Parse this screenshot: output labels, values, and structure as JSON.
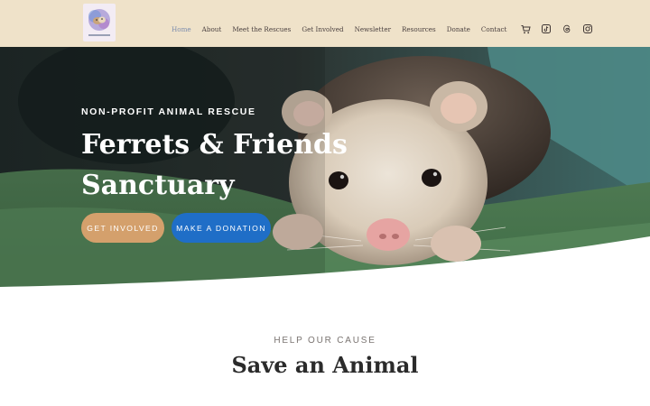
{
  "header": {
    "logo_icon": "ferret-sanctuary-logo",
    "nav": [
      {
        "label": "Home",
        "active": true
      },
      {
        "label": "About"
      },
      {
        "label": "Meet the Rescues"
      },
      {
        "label": "Get Involved"
      },
      {
        "label": "Newsletter"
      },
      {
        "label": "Resources"
      },
      {
        "label": "Donate"
      },
      {
        "label": "Contact"
      }
    ],
    "icons": [
      "cart-icon",
      "tiktok-icon",
      "threads-icon",
      "instagram-icon"
    ]
  },
  "hero": {
    "eyebrow": "NON-PROFIT ANIMAL RESCUE",
    "title_line1": "Ferrets & Friends",
    "title_line2": "Sanctuary",
    "button_involved": "GET INVOLVED",
    "button_donate": "MAKE A DONATION",
    "image_subject": "ferret on green blanket"
  },
  "section": {
    "kicker": "HELP OUR CAUSE",
    "title": "Save an Animal"
  },
  "colors": {
    "header_bg": "#efe2c9",
    "accent_tan": "#d4a06c",
    "accent_blue": "#1f6ec7",
    "nav_active": "#7b8cad"
  }
}
